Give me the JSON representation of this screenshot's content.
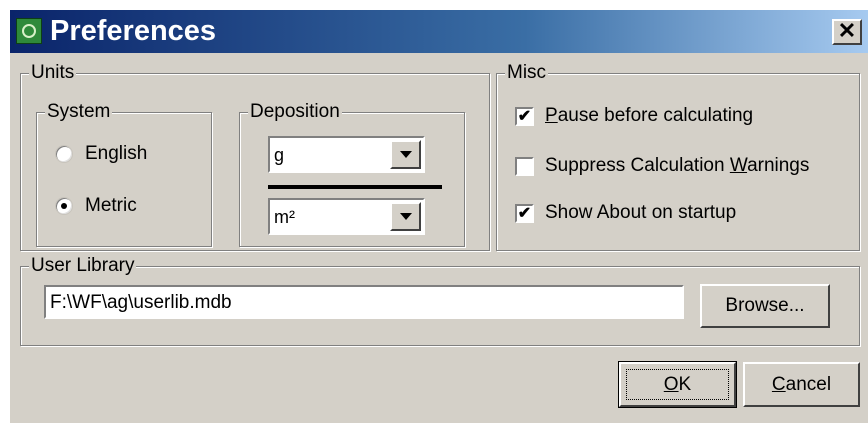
{
  "window": {
    "title": "Preferences",
    "app_icon": "globe-icon",
    "close_label": "✕"
  },
  "units": {
    "title": "Units",
    "system": {
      "title": "System",
      "options": [
        {
          "label": "English",
          "selected": false
        },
        {
          "label": "Metric",
          "selected": true
        }
      ]
    },
    "deposition": {
      "title": "Deposition",
      "numerator": "g",
      "denominator": "m²"
    }
  },
  "misc": {
    "title": "Misc",
    "options": [
      {
        "pre": "",
        "accel": "P",
        "post": "ause before calculating",
        "checked": true
      },
      {
        "pre": "Suppress Calculation ",
        "accel": "W",
        "post": "arnings",
        "checked": false
      },
      {
        "pre": "Show About on startup",
        "accel": "",
        "post": "",
        "checked": true
      }
    ]
  },
  "user_library": {
    "title": "User Library",
    "path": "F:\\WF\\ag\\userlib.mdb",
    "browse_label": "Browse..."
  },
  "buttons": {
    "ok": {
      "accel": "O",
      "rest": "K"
    },
    "cancel": {
      "accel": "C",
      "rest": "ancel"
    }
  }
}
